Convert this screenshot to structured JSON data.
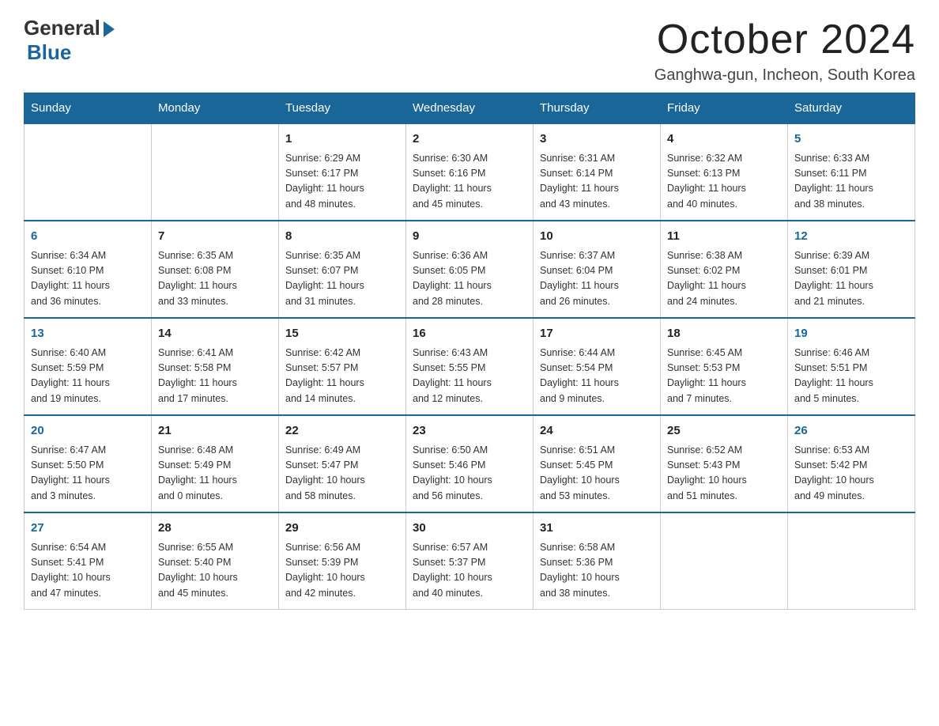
{
  "header": {
    "logo_general": "General",
    "logo_blue": "Blue",
    "title": "October 2024",
    "location": "Ganghwa-gun, Incheon, South Korea"
  },
  "days_of_week": [
    "Sunday",
    "Monday",
    "Tuesday",
    "Wednesday",
    "Thursday",
    "Friday",
    "Saturday"
  ],
  "weeks": [
    [
      {
        "num": "",
        "info": ""
      },
      {
        "num": "",
        "info": ""
      },
      {
        "num": "1",
        "info": "Sunrise: 6:29 AM\nSunset: 6:17 PM\nDaylight: 11 hours\nand 48 minutes."
      },
      {
        "num": "2",
        "info": "Sunrise: 6:30 AM\nSunset: 6:16 PM\nDaylight: 11 hours\nand 45 minutes."
      },
      {
        "num": "3",
        "info": "Sunrise: 6:31 AM\nSunset: 6:14 PM\nDaylight: 11 hours\nand 43 minutes."
      },
      {
        "num": "4",
        "info": "Sunrise: 6:32 AM\nSunset: 6:13 PM\nDaylight: 11 hours\nand 40 minutes."
      },
      {
        "num": "5",
        "info": "Sunrise: 6:33 AM\nSunset: 6:11 PM\nDaylight: 11 hours\nand 38 minutes."
      }
    ],
    [
      {
        "num": "6",
        "info": "Sunrise: 6:34 AM\nSunset: 6:10 PM\nDaylight: 11 hours\nand 36 minutes."
      },
      {
        "num": "7",
        "info": "Sunrise: 6:35 AM\nSunset: 6:08 PM\nDaylight: 11 hours\nand 33 minutes."
      },
      {
        "num": "8",
        "info": "Sunrise: 6:35 AM\nSunset: 6:07 PM\nDaylight: 11 hours\nand 31 minutes."
      },
      {
        "num": "9",
        "info": "Sunrise: 6:36 AM\nSunset: 6:05 PM\nDaylight: 11 hours\nand 28 minutes."
      },
      {
        "num": "10",
        "info": "Sunrise: 6:37 AM\nSunset: 6:04 PM\nDaylight: 11 hours\nand 26 minutes."
      },
      {
        "num": "11",
        "info": "Sunrise: 6:38 AM\nSunset: 6:02 PM\nDaylight: 11 hours\nand 24 minutes."
      },
      {
        "num": "12",
        "info": "Sunrise: 6:39 AM\nSunset: 6:01 PM\nDaylight: 11 hours\nand 21 minutes."
      }
    ],
    [
      {
        "num": "13",
        "info": "Sunrise: 6:40 AM\nSunset: 5:59 PM\nDaylight: 11 hours\nand 19 minutes."
      },
      {
        "num": "14",
        "info": "Sunrise: 6:41 AM\nSunset: 5:58 PM\nDaylight: 11 hours\nand 17 minutes."
      },
      {
        "num": "15",
        "info": "Sunrise: 6:42 AM\nSunset: 5:57 PM\nDaylight: 11 hours\nand 14 minutes."
      },
      {
        "num": "16",
        "info": "Sunrise: 6:43 AM\nSunset: 5:55 PM\nDaylight: 11 hours\nand 12 minutes."
      },
      {
        "num": "17",
        "info": "Sunrise: 6:44 AM\nSunset: 5:54 PM\nDaylight: 11 hours\nand 9 minutes."
      },
      {
        "num": "18",
        "info": "Sunrise: 6:45 AM\nSunset: 5:53 PM\nDaylight: 11 hours\nand 7 minutes."
      },
      {
        "num": "19",
        "info": "Sunrise: 6:46 AM\nSunset: 5:51 PM\nDaylight: 11 hours\nand 5 minutes."
      }
    ],
    [
      {
        "num": "20",
        "info": "Sunrise: 6:47 AM\nSunset: 5:50 PM\nDaylight: 11 hours\nand 3 minutes."
      },
      {
        "num": "21",
        "info": "Sunrise: 6:48 AM\nSunset: 5:49 PM\nDaylight: 11 hours\nand 0 minutes."
      },
      {
        "num": "22",
        "info": "Sunrise: 6:49 AM\nSunset: 5:47 PM\nDaylight: 10 hours\nand 58 minutes."
      },
      {
        "num": "23",
        "info": "Sunrise: 6:50 AM\nSunset: 5:46 PM\nDaylight: 10 hours\nand 56 minutes."
      },
      {
        "num": "24",
        "info": "Sunrise: 6:51 AM\nSunset: 5:45 PM\nDaylight: 10 hours\nand 53 minutes."
      },
      {
        "num": "25",
        "info": "Sunrise: 6:52 AM\nSunset: 5:43 PM\nDaylight: 10 hours\nand 51 minutes."
      },
      {
        "num": "26",
        "info": "Sunrise: 6:53 AM\nSunset: 5:42 PM\nDaylight: 10 hours\nand 49 minutes."
      }
    ],
    [
      {
        "num": "27",
        "info": "Sunrise: 6:54 AM\nSunset: 5:41 PM\nDaylight: 10 hours\nand 47 minutes."
      },
      {
        "num": "28",
        "info": "Sunrise: 6:55 AM\nSunset: 5:40 PM\nDaylight: 10 hours\nand 45 minutes."
      },
      {
        "num": "29",
        "info": "Sunrise: 6:56 AM\nSunset: 5:39 PM\nDaylight: 10 hours\nand 42 minutes."
      },
      {
        "num": "30",
        "info": "Sunrise: 6:57 AM\nSunset: 5:37 PM\nDaylight: 10 hours\nand 40 minutes."
      },
      {
        "num": "31",
        "info": "Sunrise: 6:58 AM\nSunset: 5:36 PM\nDaylight: 10 hours\nand 38 minutes."
      },
      {
        "num": "",
        "info": ""
      },
      {
        "num": "",
        "info": ""
      }
    ]
  ]
}
